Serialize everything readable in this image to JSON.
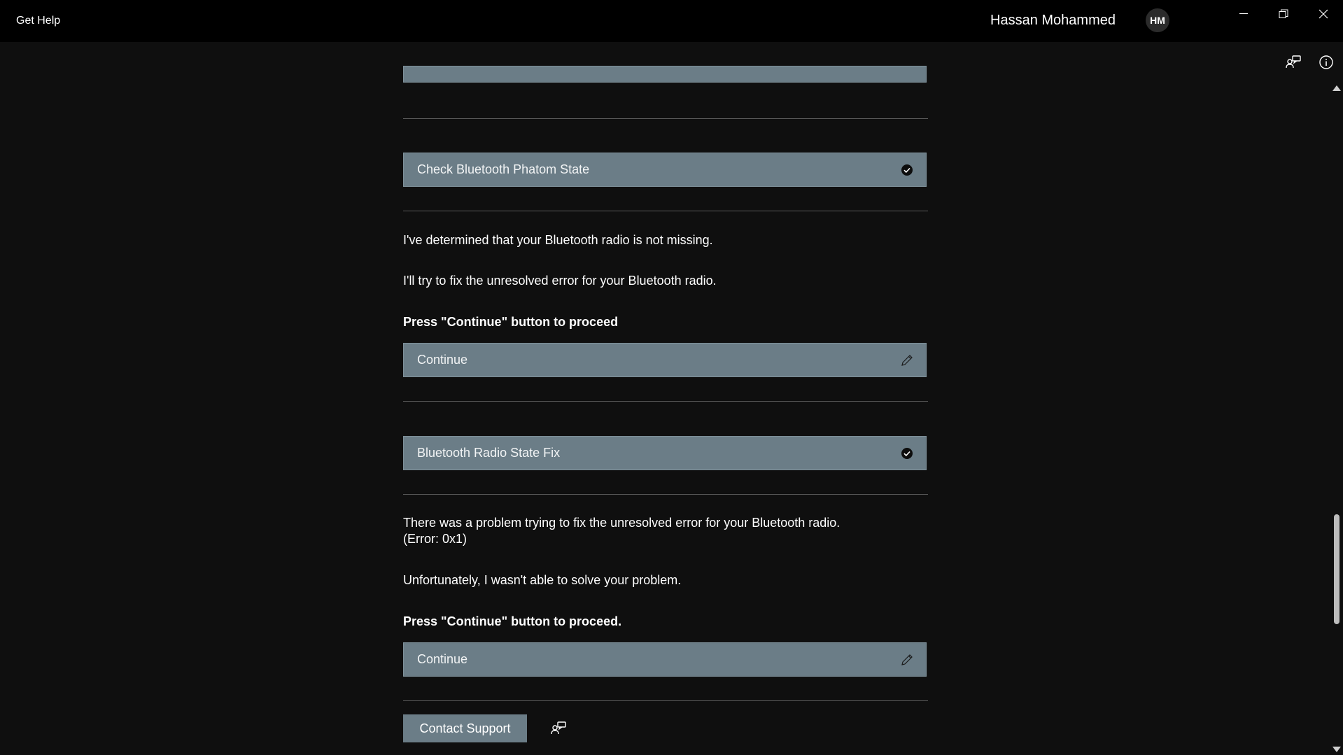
{
  "window": {
    "app_title": "Get Help",
    "user_name": "Hassan Mohammed",
    "user_initials": "HM",
    "controls": [
      "minimize-icon",
      "restore-icon",
      "close-icon"
    ]
  },
  "toolbar": {
    "icons": [
      "contact-support-icon",
      "info-icon"
    ]
  },
  "conversation": {
    "top_bar": {
      "label": "",
      "icon": "pencil-icon"
    },
    "check_bar": {
      "label": "Check Bluetooth Phatom State",
      "icon": "checkmark-circle-icon"
    },
    "msg1": "I've determined that your Bluetooth radio is not missing.",
    "msg2": "I'll try to fix the unresolved error for your Bluetooth radio.",
    "prompt1": "Press \"Continue\" button to proceed",
    "continue1": {
      "label": "Continue",
      "icon": "pencil-icon"
    },
    "fix_bar": {
      "label": "Bluetooth Radio State Fix",
      "icon": "checkmark-circle-icon"
    },
    "msg3": "There was a problem trying to fix the unresolved error for your Bluetooth radio. (Error: 0x1)",
    "msg4": "Unfortunately, I wasn't able to solve your problem.",
    "prompt2": "Press \"Continue\" button to proceed.",
    "continue2": {
      "label": "Continue",
      "icon": "pencil-icon"
    },
    "contact_support_label": "Contact Support"
  },
  "colors": {
    "background": "#0f0f0f",
    "titlebar": "#000000",
    "bar_fill": "#6b7d87",
    "divider": "#5a5a5a",
    "text": "#ffffff"
  }
}
